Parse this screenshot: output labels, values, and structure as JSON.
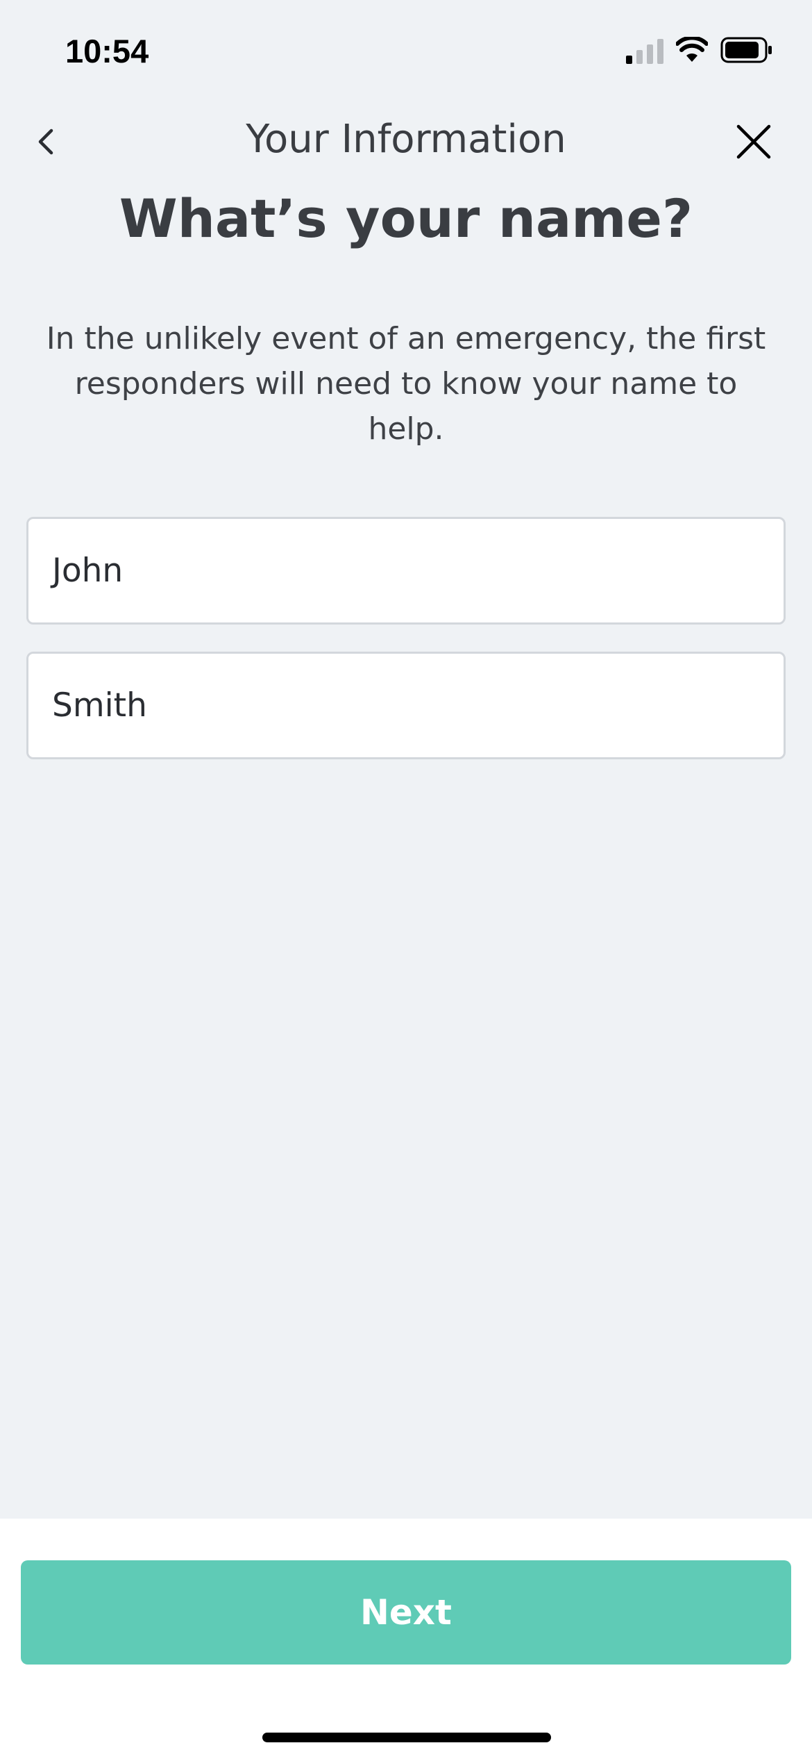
{
  "status_bar": {
    "time": "10:54",
    "icons": [
      "cellular-signal-icon",
      "wifi-icon",
      "battery-icon"
    ]
  },
  "nav": {
    "title": "Your Information",
    "back_icon": "chevron-left-icon",
    "close_icon": "close-icon"
  },
  "page": {
    "heading": "What’s your name?",
    "description": "In the unlikely event of an emergency, the first responders will need to know your name to help."
  },
  "form": {
    "first_name": "John",
    "last_name": "Smith"
  },
  "footer": {
    "next_label": "Next"
  },
  "colors": {
    "background": "#eff2f5",
    "accent": "#5fcbb6",
    "text": "#3a3d42"
  }
}
